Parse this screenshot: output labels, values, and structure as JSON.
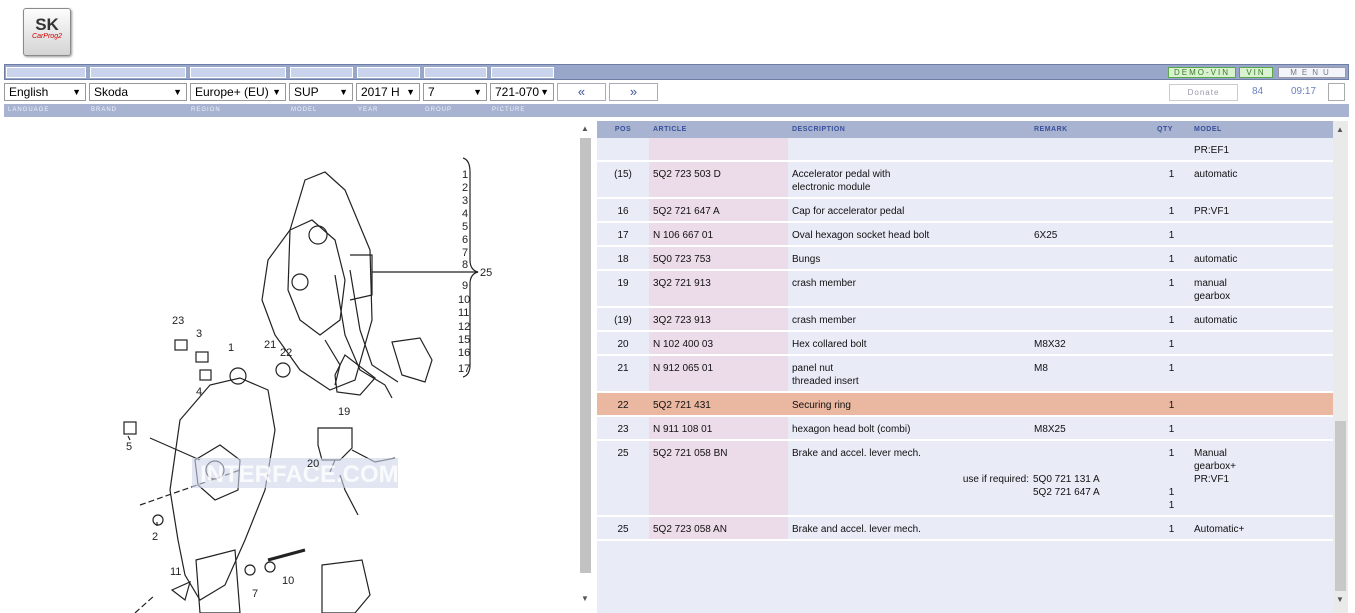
{
  "logo": {
    "text": "SK",
    "sub": "CarProg2"
  },
  "header": {
    "demo_vin": "DEMO-VIN",
    "vin": "VIN",
    "menu": "MENU"
  },
  "selectors": {
    "language": "English",
    "brand": "Skoda",
    "region": "Europe+ (EU)",
    "model": "SUP",
    "year": "2017 H",
    "group": "7",
    "picture": "721-070"
  },
  "labels": {
    "language": "LANGUAGE",
    "brand": "BRAND",
    "region": "REGION",
    "model": "MODEL",
    "year": "YEAR",
    "group": "GROUP",
    "picture": "PICTURE"
  },
  "nav": {
    "prev": "«",
    "next": "»"
  },
  "status": {
    "donate": "Donate",
    "count": "84",
    "time": "09:17"
  },
  "diagram": {
    "watermark": "INTERFACE.COM",
    "callouts": [
      "1",
      "2",
      "3",
      "4",
      "5",
      "6",
      "7",
      "8",
      "9",
      "10",
      "11",
      "12",
      "15",
      "16",
      "17",
      "25",
      "23",
      "3",
      "1",
      "21",
      "22",
      "4",
      "5",
      "19",
      "20",
      "2",
      "11",
      "7",
      "10"
    ]
  },
  "table": {
    "columns": [
      "POS",
      "ARTICLE",
      "DESCRIPTION",
      "REMARK",
      "QTY",
      "MODEL"
    ],
    "rows": [
      {
        "pos": "",
        "article": "",
        "desc": "",
        "remark": "",
        "qty": "",
        "model": "PR:EF1"
      },
      {
        "pos": "(15)",
        "article": "5Q2 723 503 D",
        "desc": "Accelerator pedal with\nelectronic module",
        "remark": "",
        "qty": "1",
        "model": "automatic"
      },
      {
        "pos": "16",
        "article": "5Q2 721 647 A",
        "desc": "Cap for accelerator pedal",
        "remark": "",
        "qty": "1",
        "model": "PR:VF1"
      },
      {
        "pos": "17",
        "article": "N   106 667 01",
        "desc": "Oval hexagon socket head bolt",
        "remark": "6X25",
        "qty": "1",
        "model": ""
      },
      {
        "pos": "18",
        "article": "5Q0 723 753",
        "desc": "Bungs",
        "remark": "",
        "qty": "1",
        "model": "automatic"
      },
      {
        "pos": "19",
        "article": "3Q2 721 913",
        "desc": "crash member",
        "remark": "",
        "qty": "1",
        "model": "manual\ngearbox"
      },
      {
        "pos": "(19)",
        "article": "3Q2 723 913",
        "desc": "crash member",
        "remark": "",
        "qty": "1",
        "model": "automatic"
      },
      {
        "pos": "20",
        "article": "N   102 400 03",
        "desc": "Hex collared bolt",
        "remark": "M8X32",
        "qty": "1",
        "model": ""
      },
      {
        "pos": "21",
        "article": "N   912 065 01",
        "desc": "panel nut\nthreaded insert",
        "remark": "M8",
        "qty": "1",
        "model": ""
      },
      {
        "pos": "22",
        "article": "5Q2 721 431",
        "desc": "Securing ring",
        "remark": "",
        "qty": "1",
        "model": "",
        "highlight": true
      },
      {
        "pos": "23",
        "article": "N   911 108 01",
        "desc": "hexagon head bolt (combi)",
        "remark": "M8X25",
        "qty": "1",
        "model": ""
      },
      {
        "pos": "25",
        "article": "5Q2 721 058 BN",
        "desc": "Brake and accel. lever mech.",
        "remark": "",
        "qty": "1",
        "model": "Manual\ngearbox+\nPR:VF1",
        "extra_label": "use if required:",
        "extra_items": [
          {
            "article": "5Q0 721 131 A",
            "qty": "1"
          },
          {
            "article": "5Q2 721 647 A",
            "qty": "1"
          }
        ]
      },
      {
        "pos": "25",
        "article": "5Q2 723 058 AN",
        "desc": "Brake and accel. lever mech.",
        "remark": "",
        "qty": "1",
        "model": "Automatic+"
      }
    ]
  }
}
